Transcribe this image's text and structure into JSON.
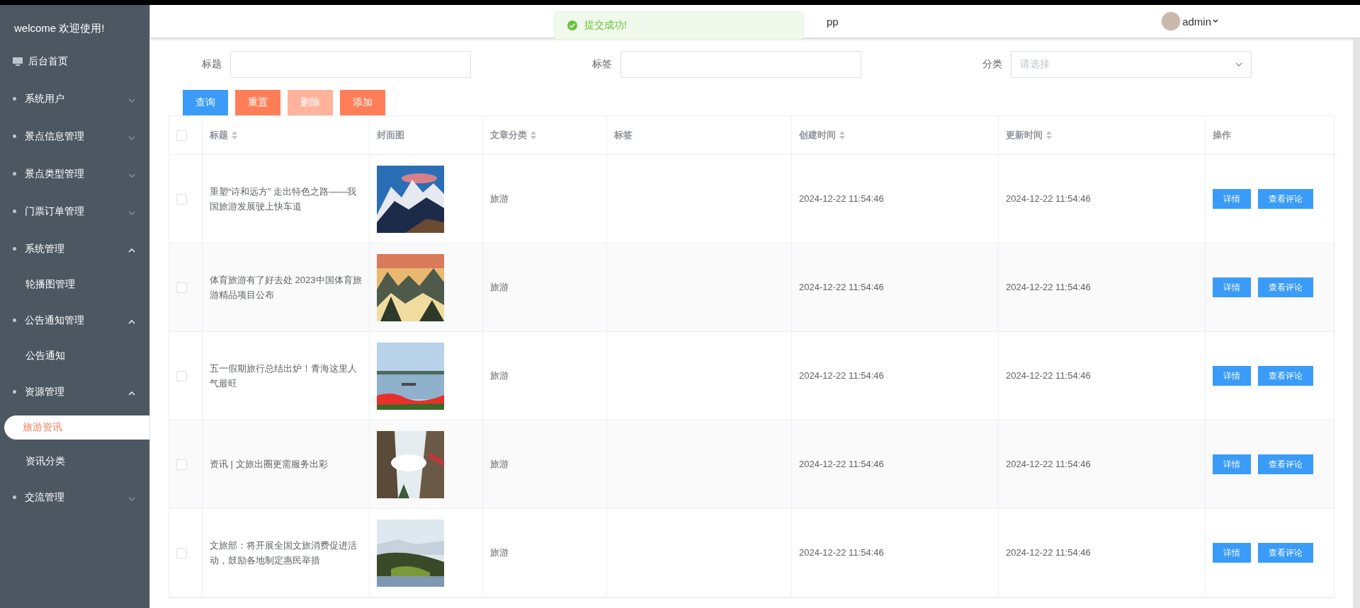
{
  "sidebar": {
    "welcome": "welcome 欢迎使用!",
    "items": [
      {
        "label": "后台首页",
        "kind": "home",
        "selected": false
      },
      {
        "label": "系统用户",
        "kind": "group",
        "expanded": false,
        "selected": false
      },
      {
        "label": "景点信息管理",
        "kind": "group",
        "expanded": false,
        "selected": false
      },
      {
        "label": "景点类型管理",
        "kind": "group",
        "expanded": false,
        "selected": false
      },
      {
        "label": "门票订单管理",
        "kind": "group",
        "expanded": false,
        "selected": false
      },
      {
        "label": "系统管理",
        "kind": "group",
        "expanded": true,
        "selected": false,
        "children": [
          {
            "label": "轮播图管理",
            "selected": false
          }
        ]
      },
      {
        "label": "公告通知管理",
        "kind": "group",
        "expanded": true,
        "selected": false,
        "children": [
          {
            "label": "公告通知",
            "selected": false
          }
        ]
      },
      {
        "label": "资源管理",
        "kind": "group",
        "expanded": true,
        "selected": false,
        "children": [
          {
            "label": "旅游资讯",
            "selected": true
          },
          {
            "label": "资讯分类",
            "selected": false
          }
        ]
      },
      {
        "label": "交流管理",
        "kind": "group",
        "expanded": false,
        "selected": false
      }
    ]
  },
  "header": {
    "title": "pp",
    "user": "admin"
  },
  "toast": {
    "kind": "success",
    "message": "提交成功!"
  },
  "filters": [
    {
      "label": "标题",
      "kind": "input"
    },
    {
      "label": "标签",
      "kind": "input"
    },
    {
      "label": "分类",
      "kind": "select",
      "placeholder": "请选择"
    }
  ],
  "actions": [
    {
      "label": "查询",
      "kind": "primary",
      "disabled": false
    },
    {
      "label": "重置",
      "kind": "danger",
      "disabled": false
    },
    {
      "label": "删除",
      "kind": "danger",
      "disabled": true
    },
    {
      "label": "添加",
      "kind": "danger",
      "disabled": false
    }
  ],
  "table": {
    "select_all_checked": false,
    "columns": [
      {
        "label": "标题",
        "sortable": true
      },
      {
        "label": "封面图",
        "sortable": false
      },
      {
        "label": "文章分类",
        "sortable": true
      },
      {
        "label": "标签",
        "sortable": false
      },
      {
        "label": "创建时间",
        "sortable": true
      },
      {
        "label": "更新时间",
        "sortable": true
      },
      {
        "label": "操作",
        "sortable": false
      }
    ],
    "rows": [
      {
        "checked": false,
        "title": "重塑“诗和远方” 走出特色之路——我国旅游发展驶上快车道",
        "cover": {
          "kind": "picture"
        },
        "category": "旅游",
        "created": "2024-12-22 11:54:46",
        "updated": "2024-12-22 11:54:46",
        "buttons": [
          "详情",
          "查看评论"
        ]
      },
      {
        "checked": false,
        "title": "体育旅游有了好去处 2023中国体育旅游精品项目公布",
        "cover": {
          "kind": "picture"
        },
        "category": "旅游",
        "created": "2024-12-22 11:54:46",
        "updated": "2024-12-22 11:54:46",
        "buttons": [
          "详情",
          "查看评论"
        ]
      },
      {
        "checked": false,
        "title": "五一假期旅行总结出炉！青海这里人气最旺",
        "cover": {
          "kind": "picture"
        },
        "category": "旅游",
        "created": "2024-12-22 11:54:46",
        "updated": "2024-12-22 11:54:46",
        "buttons": [
          "详情",
          "查看评论"
        ]
      },
      {
        "checked": false,
        "title": "资讯 | 文旅出圈更需服务出彩",
        "cover": {
          "kind": "picture"
        },
        "category": "旅游",
        "created": "2024-12-22 11:54:46",
        "updated": "2024-12-22 11:54:46",
        "buttons": [
          "详情",
          "查看评论"
        ]
      },
      {
        "checked": false,
        "title": "文旅部：将开展全国文旅消费促进活动，鼓励各地制定惠民举措",
        "cover": {
          "kind": "picture"
        },
        "category": "旅游",
        "created": "2024-12-22 11:54:46",
        "updated": "2024-12-22 11:54:46",
        "buttons": [
          "详情",
          "查看评论"
        ]
      }
    ]
  }
}
